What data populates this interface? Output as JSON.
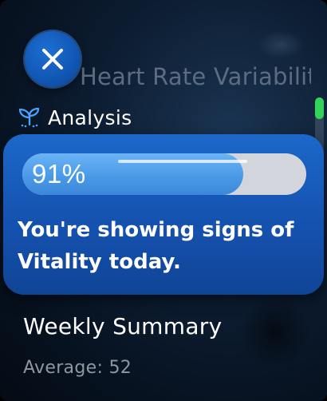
{
  "app": {
    "background_title": "Heart Rate Variability",
    "close_icon": "close-icon"
  },
  "section": {
    "label": "Analysis",
    "icon": "sprout-icon",
    "icon_color": "#4aa3ff"
  },
  "vitality": {
    "percent": 91,
    "percent_label": "91%",
    "message": "You're showing signs of Vitality today."
  },
  "weekly": {
    "title": "Weekly Summary",
    "average_label": "Average: 52"
  },
  "scroll": {
    "position_fraction": 0.0
  },
  "colors": {
    "card": "#1659bb",
    "progress_fill": "#4a9ae8",
    "progress_track": "#d2d6dc",
    "scroll_thumb": "#33d35a",
    "close_button": "#1360c2"
  }
}
